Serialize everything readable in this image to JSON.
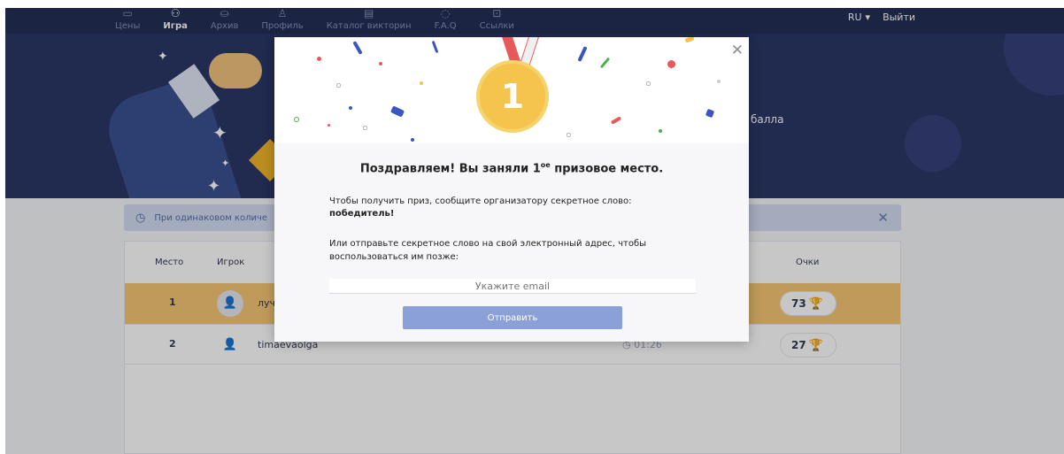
{
  "nav": {
    "items": [
      {
        "label": "Цены",
        "icon": "▭"
      },
      {
        "label": "Игра",
        "icon": "⚇"
      },
      {
        "label": "Архив",
        "icon": "⛀"
      },
      {
        "label": "Профиль",
        "icon": "♙"
      },
      {
        "label": "Каталог викторин",
        "icon": "▤"
      },
      {
        "label": "F.A.Q",
        "icon": "◌"
      },
      {
        "label": "Ссылки",
        "icon": "⊡"
      }
    ],
    "lang": "RU",
    "lang_caret": "▾",
    "logout": "Выйти"
  },
  "hero": {
    "text_fragment": "балла"
  },
  "info_bar": {
    "text": "При одинаковом количе",
    "clock_icon": "◷",
    "close_icon": "✕"
  },
  "table": {
    "headers": {
      "place": "Место",
      "player": "Игрок",
      "points": "Очки"
    },
    "rows": [
      {
        "place": "1",
        "player": "луч",
        "time": "",
        "score": "73"
      },
      {
        "place": "2",
        "player": "timaevaolga",
        "time": "01:26",
        "score": "27"
      }
    ],
    "trophy_icon": "🏆",
    "user_icon": "👤",
    "time_icon": "◷"
  },
  "modal": {
    "close_icon": "✕",
    "medal_number": "1",
    "title_before": "Поздравляем! Вы заняли 1",
    "title_sup": "ое",
    "title_after": " призовое место.",
    "instruction": "Чтобы получить приз, сообщите организатору секретное слово:",
    "secret_word": "победитель!",
    "email_text": "Или отправьте секретное слово на свой электронный адрес, чтобы воспользоваться им позже:",
    "email_placeholder": "Укажите email",
    "send_label": "Отправить"
  },
  "colors": {
    "nav_bg": "#242f57",
    "hero_bg": "#2b3666",
    "first_row": "#f5c675",
    "send_button": "#8aa0d6",
    "medal": "#f4c44d"
  }
}
